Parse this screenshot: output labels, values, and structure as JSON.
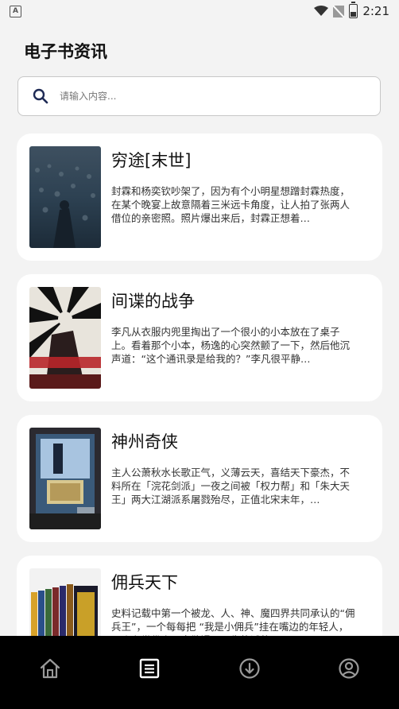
{
  "status_bar": {
    "notification_icon": "A",
    "time": "2:21",
    "icons": [
      "wifi-icon",
      "signal-off-icon",
      "battery-icon"
    ]
  },
  "page": {
    "title": "电子书资讯"
  },
  "search": {
    "placeholder": "请输入内容..."
  },
  "books": [
    {
      "title": "穷途[末世]",
      "description": "封霖和杨奕钦吵架了，因为有个小明星想蹭封霖热度，在某个晚宴上故意隔着三米远卡角度，让人拍了张两人借位的亲密照。照片爆出来后，封霖正想着…"
    },
    {
      "title": "间谍的战争",
      "description": "李凡从衣服内兜里掏出了一个很小的小本放在了桌子上。看着那个小本，杨逸的心突然颤了一下，然后他沉声道：“这个通讯录是给我的？”李凡很平静…"
    },
    {
      "title": "神州奇侠",
      "description": "主人公萧秋水长歌正气，义薄云天，喜结天下豪杰，不料所在「浣花剑派」一夜之间被「权力帮」和「朱大天王」两大江湖派系屠戮殆尽，正值北宋末年，…"
    },
    {
      "title": "佣兵天下",
      "description": "史料记载中第一个被龙、人、神、魔四界共同承认的“佣兵王”，一个每每把 “我是小佣兵”挂在嘴边的年轻人，一个在世俗人眼中散漫而不失热诚的…"
    }
  ],
  "bottom_nav": [
    {
      "icon": "home-icon",
      "active": false
    },
    {
      "icon": "list-icon",
      "active": true
    },
    {
      "icon": "download-icon",
      "active": false
    },
    {
      "icon": "user-icon",
      "active": false
    }
  ]
}
